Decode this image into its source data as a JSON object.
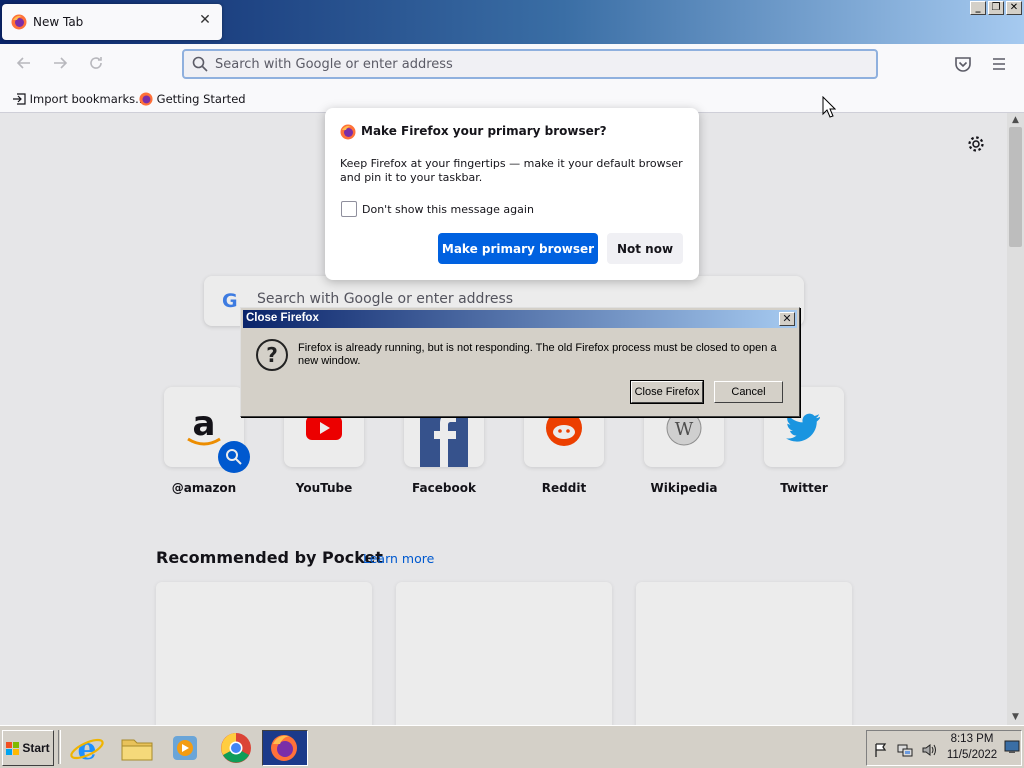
{
  "tab": {
    "title": "New Tab",
    "close": "✕"
  },
  "window_buttons": {
    "minimize": "_",
    "restore": "❐",
    "close": "✕"
  },
  "urlbar": {
    "placeholder": "Search with Google or enter address"
  },
  "bookmarks": [
    {
      "label": "Import bookmarks..."
    },
    {
      "label": "Getting Started"
    }
  ],
  "newtab": {
    "search_placeholder": "Search with Google or enter address",
    "google_glyph": "G",
    "top_sites": [
      {
        "label": "@amazon",
        "icon": "amazon-icon"
      },
      {
        "label": "YouTube",
        "icon": "youtube-icon"
      },
      {
        "label": "Facebook",
        "icon": "facebook-icon"
      },
      {
        "label": "Reddit",
        "icon": "reddit-icon"
      },
      {
        "label": "Wikipedia",
        "icon": "wikipedia-icon"
      },
      {
        "label": "Twitter",
        "icon": "twitter-icon"
      }
    ],
    "pocket_title": "Recommended by Pocket",
    "learn_more": "Learn more"
  },
  "default_popup": {
    "title": "Make Firefox your primary browser?",
    "body": "Keep Firefox at your fingertips — make it your default browser and pin it to your taskbar.",
    "checkbox_label": "Don't show this message again",
    "primary_button": "Make primary browser",
    "secondary_button": "Not now"
  },
  "close_dialog": {
    "title": "Close Firefox",
    "message": "Firefox is already running, but is not responding. The old Firefox process must be closed to open a new window.",
    "close_button": "Close Firefox",
    "cancel_button": "Cancel",
    "question_glyph": "?",
    "x": "✕"
  },
  "taskbar": {
    "start_label": "Start",
    "time": "8:13 PM",
    "date": "11/5/2022"
  },
  "colors": {
    "accent_blue": "#0061e0",
    "title_gradient_start": "#0a246a",
    "title_gradient_end": "#a6caf0"
  }
}
